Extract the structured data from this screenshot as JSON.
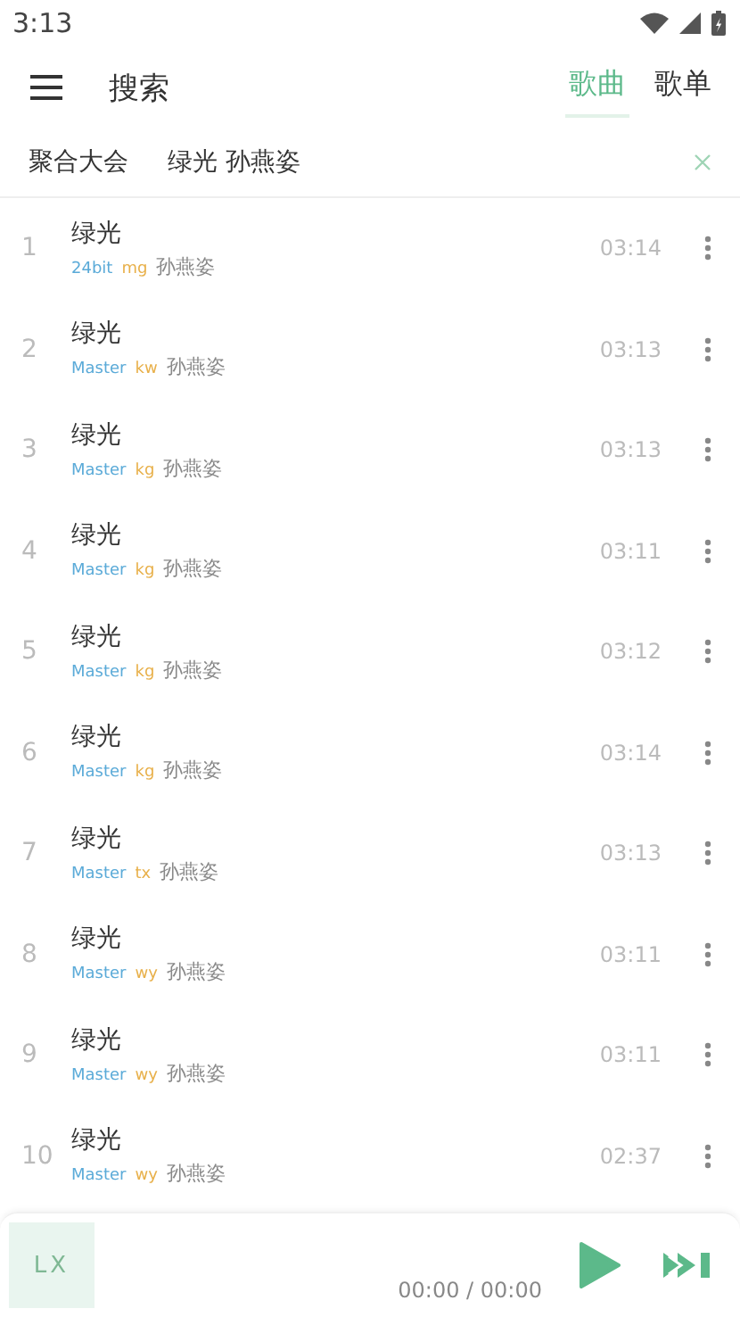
{
  "status_bar": {
    "time": "3:13"
  },
  "header": {
    "title": "搜索",
    "tabs": [
      {
        "label": "歌曲",
        "selected": true
      },
      {
        "label": "歌单",
        "selected": false
      }
    ]
  },
  "search": {
    "source": "聚合大会",
    "value": "绿光 孙燕姿"
  },
  "songs": [
    {
      "index": "1",
      "title": "绿光",
      "quality": "24bit",
      "source": "mg",
      "artist": "孙燕姿",
      "duration": "03:14"
    },
    {
      "index": "2",
      "title": "绿光",
      "quality": "Master",
      "source": "kw",
      "artist": "孙燕姿",
      "duration": "03:13"
    },
    {
      "index": "3",
      "title": "绿光",
      "quality": "Master",
      "source": "kg",
      "artist": "孙燕姿",
      "duration": "03:13"
    },
    {
      "index": "4",
      "title": "绿光",
      "quality": "Master",
      "source": "kg",
      "artist": "孙燕姿",
      "duration": "03:11"
    },
    {
      "index": "5",
      "title": "绿光",
      "quality": "Master",
      "source": "kg",
      "artist": "孙燕姿",
      "duration": "03:12"
    },
    {
      "index": "6",
      "title": "绿光",
      "quality": "Master",
      "source": "kg",
      "artist": "孙燕姿",
      "duration": "03:14"
    },
    {
      "index": "7",
      "title": "绿光",
      "quality": "Master",
      "source": "tx",
      "artist": "孙燕姿",
      "duration": "03:13"
    },
    {
      "index": "8",
      "title": "绿光",
      "quality": "Master",
      "source": "wy",
      "artist": "孙燕姿",
      "duration": "03:11"
    },
    {
      "index": "9",
      "title": "绿光",
      "quality": "Master",
      "source": "wy",
      "artist": "孙燕姿",
      "duration": "03:11"
    },
    {
      "index": "10",
      "title": "绿光",
      "quality": "Master",
      "source": "wy",
      "artist": "孙燕姿",
      "duration": "02:37"
    }
  ],
  "player": {
    "cover": "LX",
    "time": "00:00 / 00:00"
  }
}
